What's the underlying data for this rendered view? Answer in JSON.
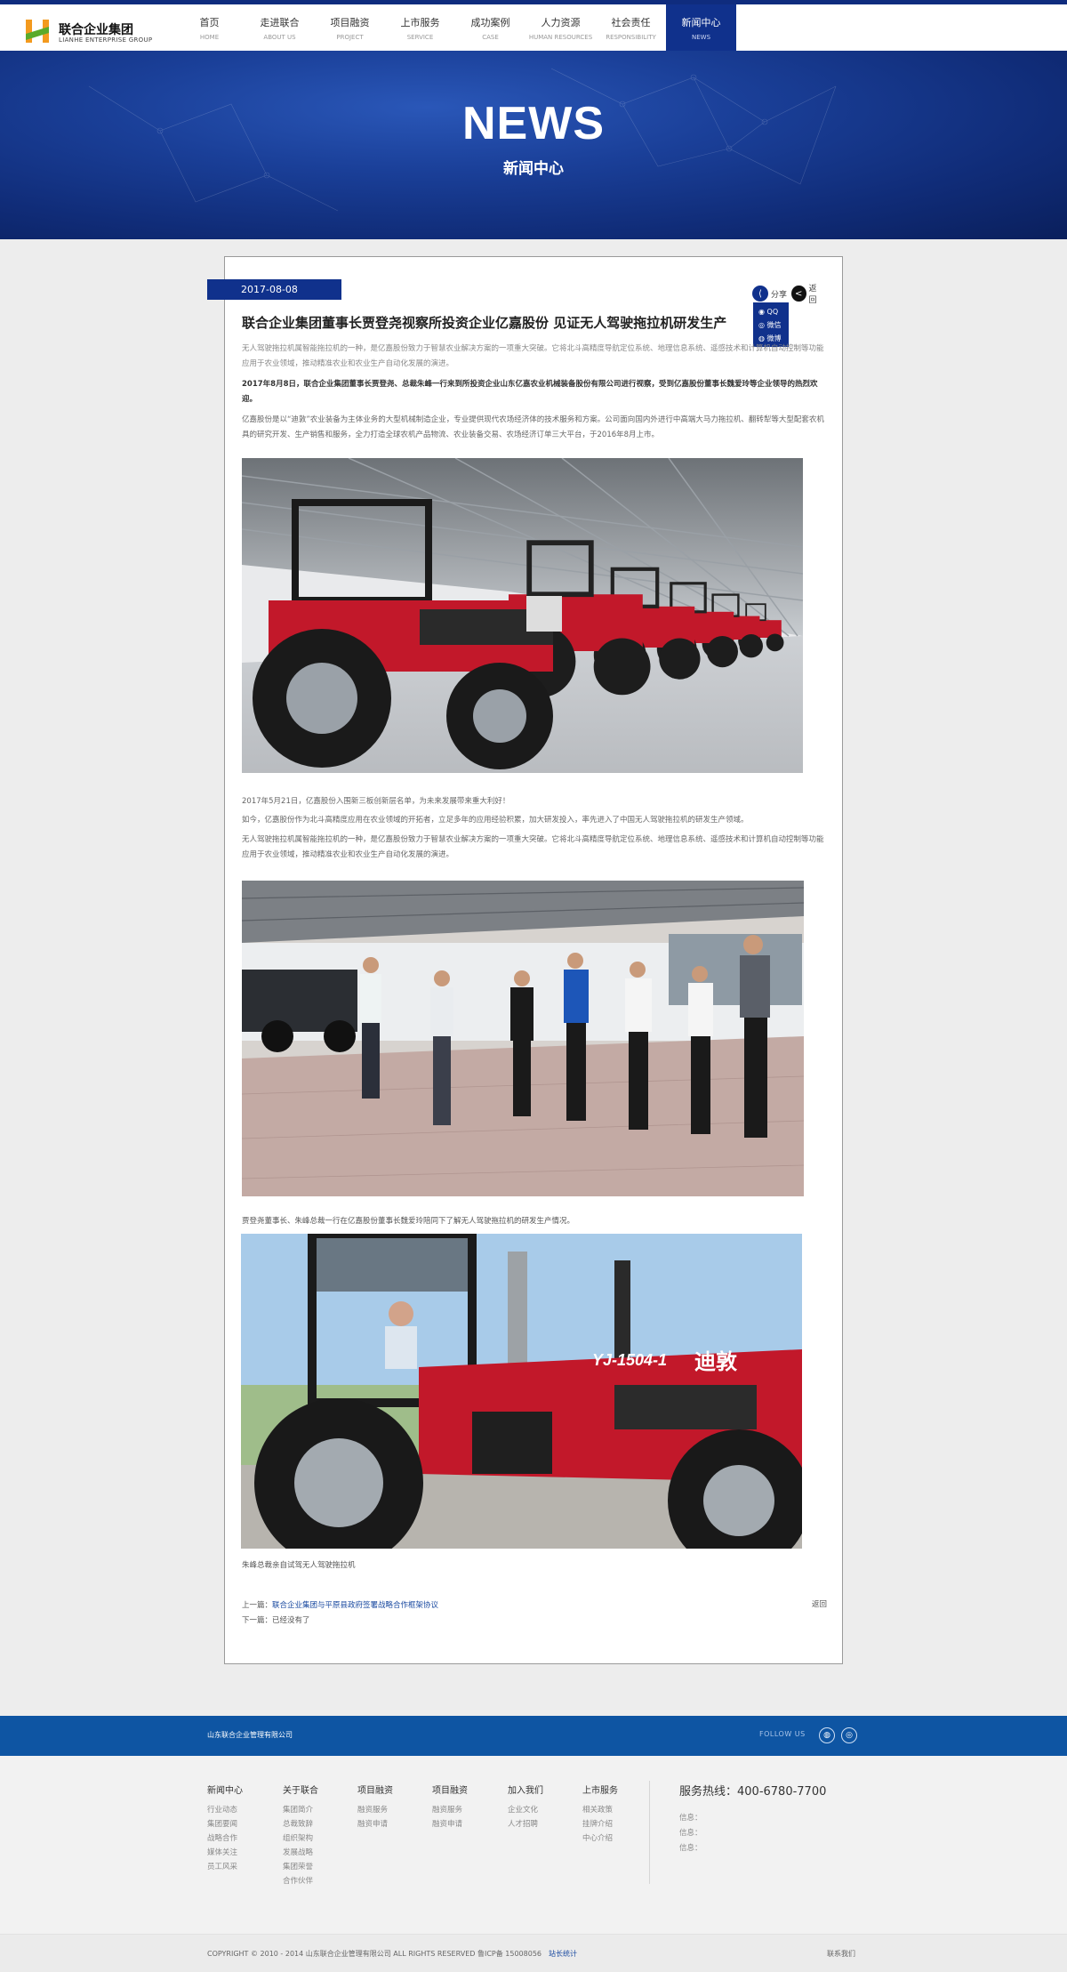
{
  "brand": {
    "name_cn": "联合企业集团",
    "name_en": "LIANHE ENTERPRISE GROUP"
  },
  "nav": [
    {
      "cn": "首页",
      "en": "HOME"
    },
    {
      "cn": "走进联合",
      "en": "ABOUT US"
    },
    {
      "cn": "项目融资",
      "en": "PROJECT"
    },
    {
      "cn": "上市服务",
      "en": "SERVICE"
    },
    {
      "cn": "成功案例",
      "en": "CASE"
    },
    {
      "cn": "人力资源",
      "en": "HUMAN RESOURCES"
    },
    {
      "cn": "社会责任",
      "en": "RESPONSIBILITY"
    },
    {
      "cn": "新闻中心",
      "en": "NEWS"
    }
  ],
  "banner": {
    "title": "NEWS",
    "subtitle": "新闻中心"
  },
  "article": {
    "date": "2017-08-08",
    "title": "联合企业集团董事长贾登尧视察所投资企业亿嘉股份 见证无人驾驶拖拉机研发生产",
    "summary": "无人驾驶拖拉机属智能拖拉机的一种，是亿嘉股份致力于智慧农业解决方案的一项重大突破。它将北斗高精度导航定位系统、地理信息系统、遥感技术和计算机自动控制等功能应用于农业领域，推动精准农业和农业生产自动化发展的演进。",
    "lead": "2017年8月8日，联合企业集团董事长贾登尧、总裁朱峰一行来到所投资企业山东亿嘉农业机械装备股份有限公司进行视察，受到亿嘉股份董事长魏爱玲等企业领导的热烈欢迎。",
    "intro": "亿嘉股份是以“迪敦”农业装备为主体业务的大型机械制造企业，专业提供现代农场经济体的技术服务和方案。公司面向国内外进行中高端大马力拖拉机、翻转犁等大型配套农机具的研究开发、生产销售和服务，全力打造全球农机产品物流、农业装备交易、农场经济订单三大平台，于2016年8月上市。",
    "para_listing": "2017年5月21日，亿嘉股份入围新三板创新层名单，为未来发展带来重大利好！",
    "para_now": "如今，亿嘉股份作为北斗高精度应用在农业领域的开拓者，立足多年的应用经验积累，加大研发投入，率先进入了中国无人驾驶拖拉机的研发生产领域。",
    "para_repeat": " 无人驾驶拖拉机属智能拖拉机的一种，是亿嘉股份致力于智慧农业解决方案的一项重大突破。它将北斗高精度导航定位系统、地理信息系统、遥感技术和计算机自动控制等功能应用于农业领域，推动精准农业和农业生产自动化发展的演进。",
    "caption_visit": "贾登尧董事长、朱峰总裁一行在亿嘉股份董事长魏爱玲陪同下了解无人驾驶拖拉机的研发生产情况。",
    "caption_drive": "朱峰总裁亲自试驾无人驾驶拖拉机",
    "tractor_model": "YJ-1504-1",
    "tractor_brand": "迪敦"
  },
  "share": {
    "share_label": "分享",
    "back_label": "返回",
    "qq": "QQ",
    "wechat": "微信",
    "weibo": "微博"
  },
  "pager": {
    "prev_label": "上一篇：",
    "prev_title": "联合企业集团与平原县政府签署战略合作框架协议",
    "next_label": "下一篇：",
    "next_title": "已经没有了",
    "back": "返回"
  },
  "footer": {
    "company": "山东联合企业管理有限公司",
    "follow": "FOLLOW US",
    "columns": [
      {
        "title": "新闻中心",
        "items": [
          "行业动态",
          "集团要闻",
          "战略合作",
          "媒体关注",
          "员工风采"
        ]
      },
      {
        "title": "关于联合",
        "items": [
          "集团简介",
          "总裁致辞",
          "组织架构",
          "发展战略",
          "集团荣誉",
          "合作伙伴"
        ]
      },
      {
        "title": "项目融资",
        "items": [
          "融资服务",
          "融资申请"
        ]
      },
      {
        "title": "项目融资",
        "items": [
          "融资服务",
          "融资申请"
        ]
      },
      {
        "title": "加入我们",
        "items": [
          "企业文化",
          "人才招聘"
        ]
      },
      {
        "title": "上市服务",
        "items": [
          "相关政策",
          "挂牌介绍",
          "中心介绍"
        ]
      }
    ],
    "hotline": "服务热线：400-6780-7700",
    "info": [
      "信息：",
      "信息：",
      "信息："
    ],
    "copyright": "COPYRIGHT © 2010 - 2014 山东联合企业管理有限公司 ALL RIGHTS RESERVED 鲁ICP备 15008056",
    "stat": "站长统计",
    "contact": "联系我们"
  },
  "colors": {
    "primary": "#10318c",
    "footer_bar": "#0e55a3",
    "tractor_red": "#c2182a"
  },
  "icons": [
    "share-icon",
    "back-icon",
    "qq-icon",
    "wechat-icon",
    "weibo-icon",
    "logo-icon"
  ]
}
